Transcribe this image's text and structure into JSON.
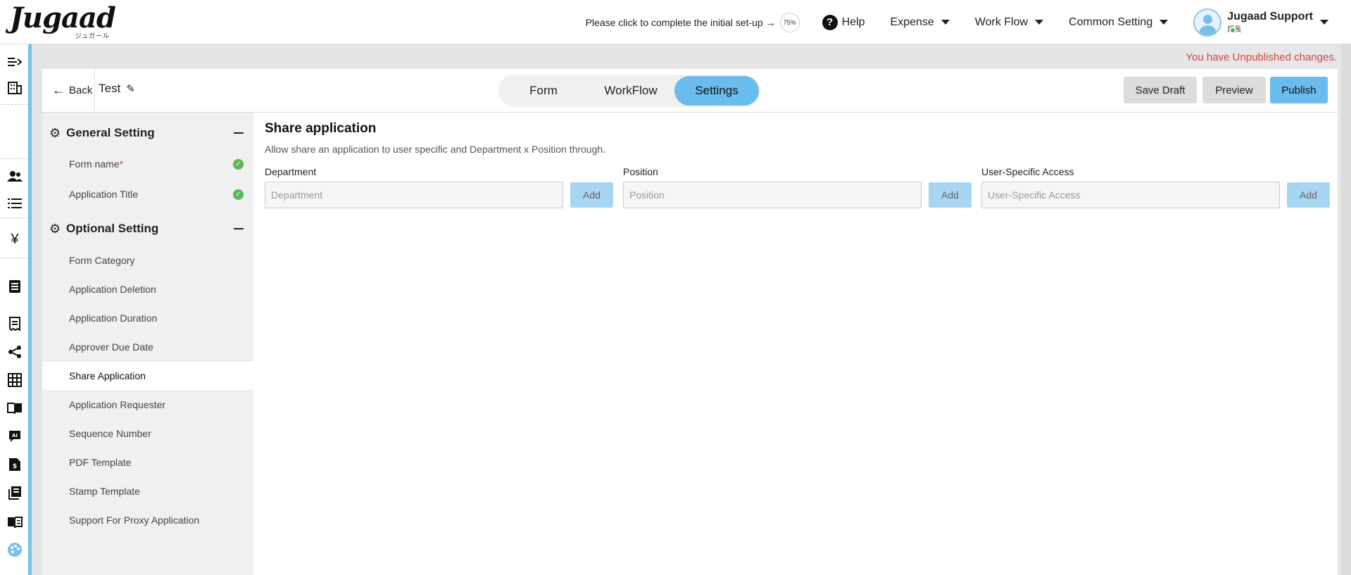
{
  "app": {
    "logo_text": "Jugaad",
    "logo_sub": "ジュガール"
  },
  "topbar": {
    "setup_text": "Please click to complete the initial set-up →",
    "setup_progress": "75%",
    "help_label": "Help",
    "menus": [
      "Expense",
      "Work Flow",
      "Common Setting"
    ],
    "user_name": "Jugaad Support",
    "user_role": "課長"
  },
  "notice": "You have Unpublished changes.",
  "header": {
    "back_label": "Back",
    "form_title": "Test",
    "tabs": [
      "Form",
      "WorkFlow",
      "Settings"
    ],
    "active_tab": "Settings",
    "save_draft_label": "Save Draft",
    "preview_label": "Preview",
    "publish_label": "Publish"
  },
  "sidebar": {
    "general_heading": "General Setting",
    "general_items": [
      {
        "label": "Form name",
        "required": "*",
        "done": true
      },
      {
        "label": "Application Title",
        "done": true
      }
    ],
    "optional_heading": "Optional Setting",
    "optional_items": [
      "Form Category",
      "Application Deletion",
      "Application Duration",
      "Approver Due Date",
      "Share Application",
      "Application Requester",
      "Sequence Number",
      "PDF Template",
      "Stamp Template",
      "Support For Proxy Application"
    ],
    "active_item": "Share Application"
  },
  "content": {
    "title": "Share application",
    "description": "Allow share an application to user specific and Department x Position through.",
    "fields": [
      {
        "label": "Department",
        "placeholder": "Department",
        "button": "Add"
      },
      {
        "label": "Position",
        "placeholder": "Position",
        "button": "Add"
      },
      {
        "label": "User-Specific Access",
        "placeholder": "User-Specific Access",
        "button": "Add"
      }
    ]
  },
  "colors": {
    "accent": "#6bbcee",
    "add_button": "#a6d6f2",
    "warning": "#d64545",
    "success": "#5cb85c",
    "sidebar_bg": "#f0f0f0"
  },
  "icons": {
    "left_nav": [
      "menu-collapse-icon",
      "building-icon",
      "users-icon",
      "list-icon",
      "yen-icon",
      "document-icon",
      "receipt-icon",
      "share-icon",
      "grid-icon",
      "book-icon",
      "ai-chat-icon",
      "invoice-icon",
      "library-icon",
      "manual-icon",
      "palette-icon"
    ]
  }
}
